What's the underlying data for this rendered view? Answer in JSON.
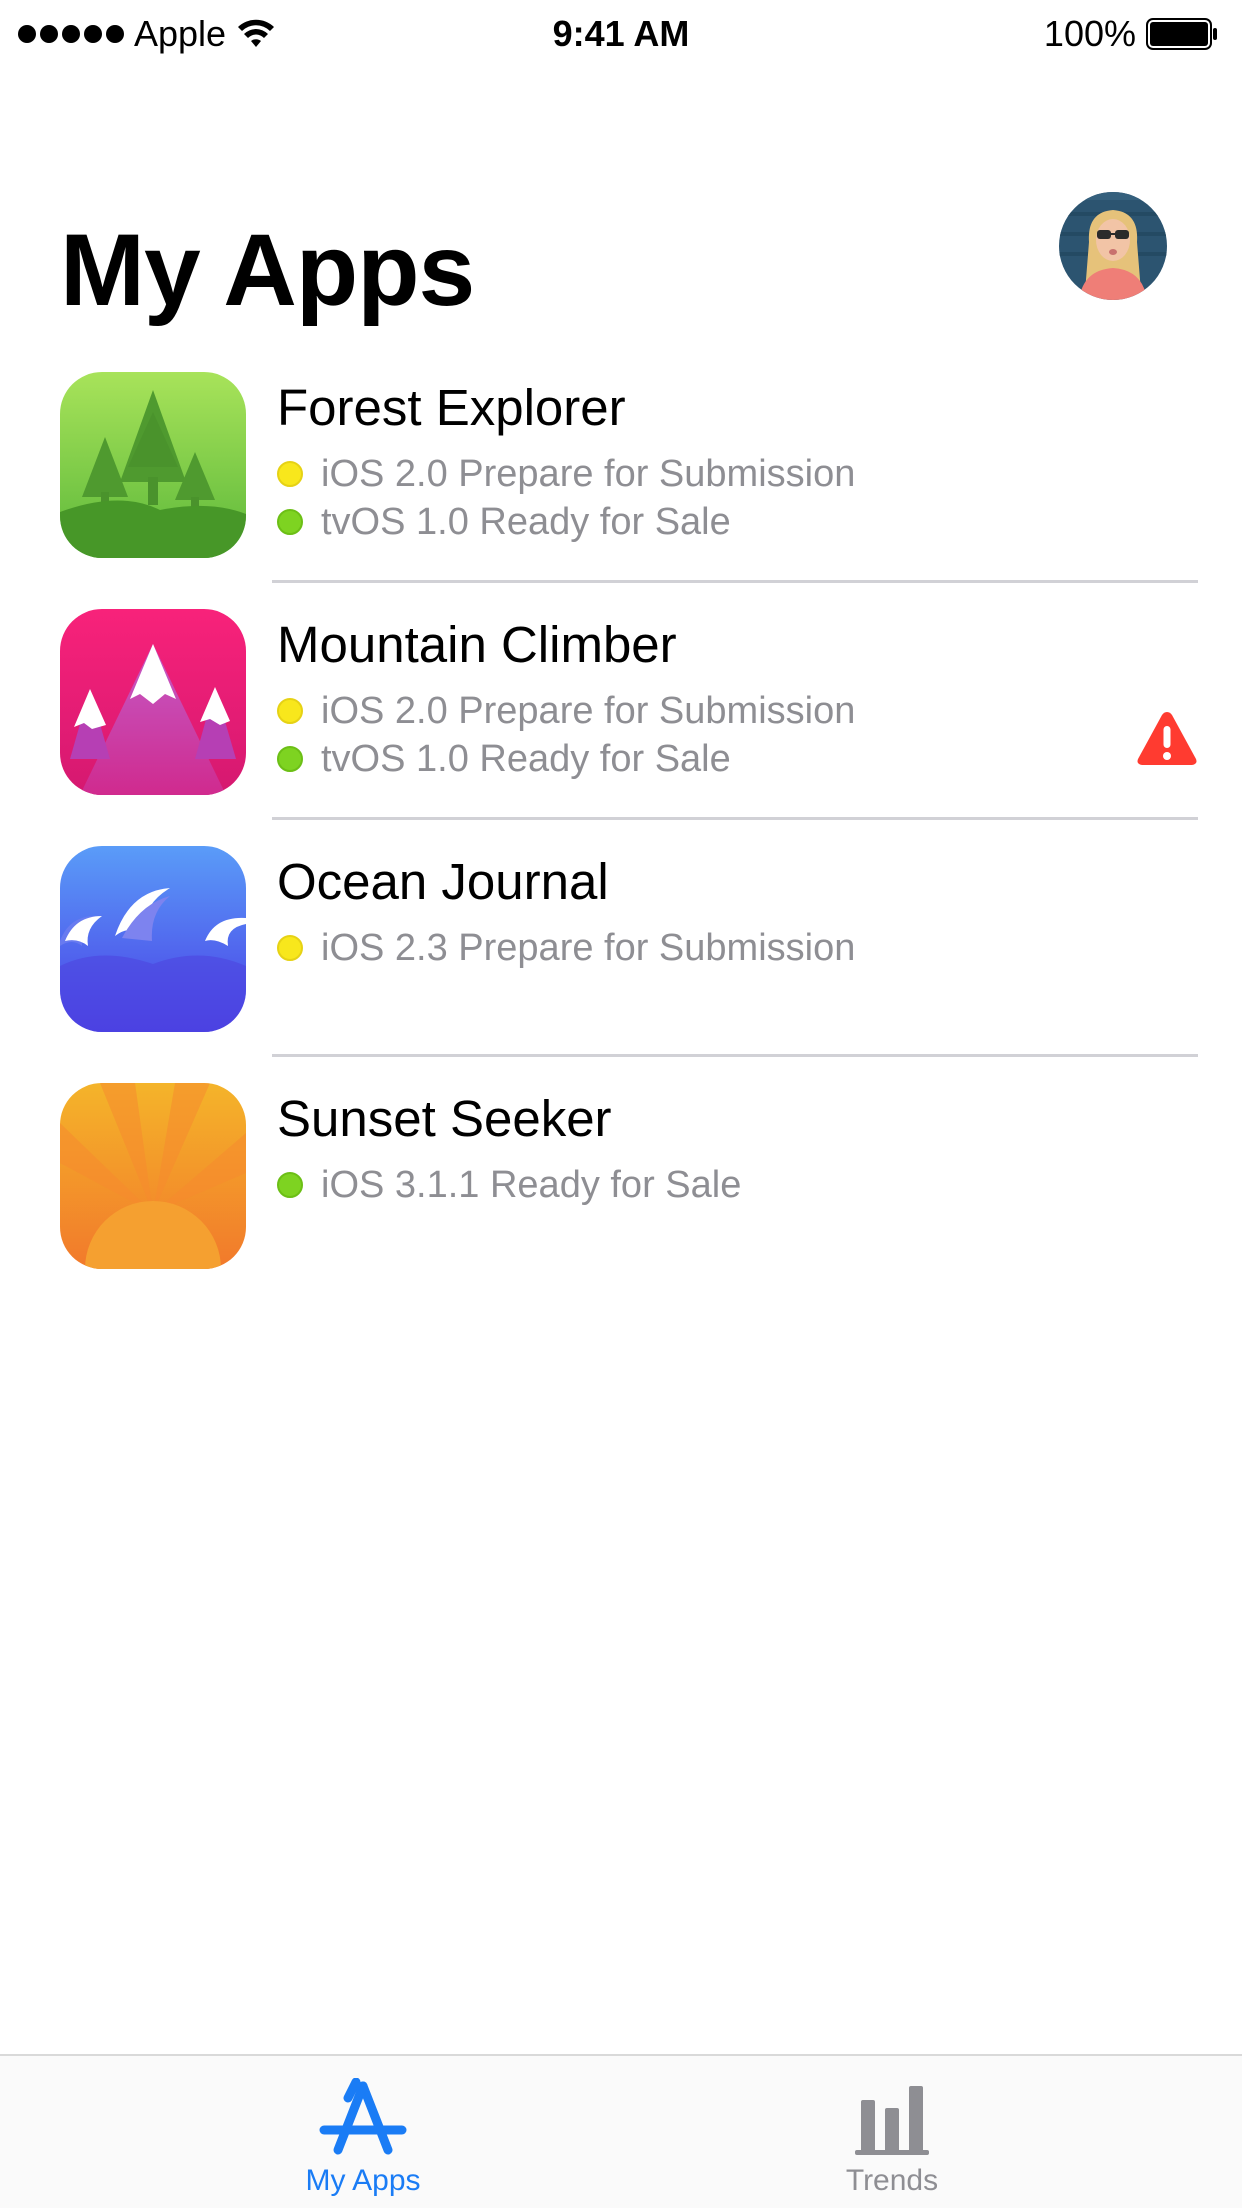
{
  "status_bar": {
    "carrier": "Apple",
    "time": "9:41 AM",
    "battery": "100%"
  },
  "header": {
    "title": "My Apps"
  },
  "apps": [
    {
      "name": "Forest Explorer",
      "icon": "forest-icon",
      "statuses": [
        {
          "text": "iOS 2.0 Prepare for Submission",
          "color": "yellow"
        },
        {
          "text": "tvOS 1.0 Ready for Sale",
          "color": "green"
        }
      ]
    },
    {
      "name": "Mountain Climber",
      "icon": "mountain-icon",
      "warning": true,
      "statuses": [
        {
          "text": "iOS 2.0 Prepare for Submission",
          "color": "yellow"
        },
        {
          "text": "tvOS 1.0 Ready for Sale",
          "color": "green"
        }
      ]
    },
    {
      "name": "Ocean Journal",
      "icon": "ocean-icon",
      "statuses": [
        {
          "text": "iOS 2.3 Prepare for Submission",
          "color": "yellow"
        }
      ]
    },
    {
      "name": "Sunset Seeker",
      "icon": "sunset-icon",
      "statuses": [
        {
          "text": "iOS 3.1.1 Ready for Sale",
          "color": "green"
        }
      ]
    }
  ],
  "tab_bar": {
    "tabs": [
      {
        "label": "My Apps",
        "icon": "app-store-icon",
        "selected": true
      },
      {
        "label": "Trends",
        "icon": "bar-chart-icon",
        "selected": false
      }
    ]
  },
  "colors": {
    "accent": "#1a7cf5",
    "status_yellow": "#f8e71c",
    "status_green": "#7ed321",
    "warning": "#ff3b30",
    "secondary_text": "#8e8e93"
  }
}
